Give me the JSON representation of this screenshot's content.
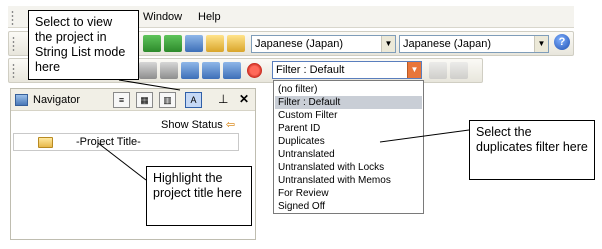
{
  "menu": {
    "window": "Window",
    "help": "Help"
  },
  "toolbar": {
    "source_language": "Japanese (Japan)",
    "target_language": "Japanese (Japan)",
    "filter_value": "Filter : Default",
    "help_icon": "help-icon"
  },
  "navigator": {
    "title": "Navigator",
    "show_status": "Show Status",
    "project_title": "-Project Title-"
  },
  "filter_dropdown": {
    "options": [
      "(no filter)",
      "Filter : Default",
      "Custom Filter",
      "Parent ID",
      "Duplicates",
      "Untranslated",
      "Untranslated with Locks",
      "Untranslated with Memos",
      "For Review",
      "Signed Off"
    ],
    "selected": "Filter : Default"
  },
  "callouts": {
    "string_list": "Select to view the project in String List mode here",
    "highlight_title": "Highlight the project title here",
    "duplicates": "Select the duplicates filter here"
  },
  "colors": {
    "selected_item": "#c9ced6",
    "filter_arrow": "#e8763a",
    "active_view": "#c5d8f5"
  }
}
